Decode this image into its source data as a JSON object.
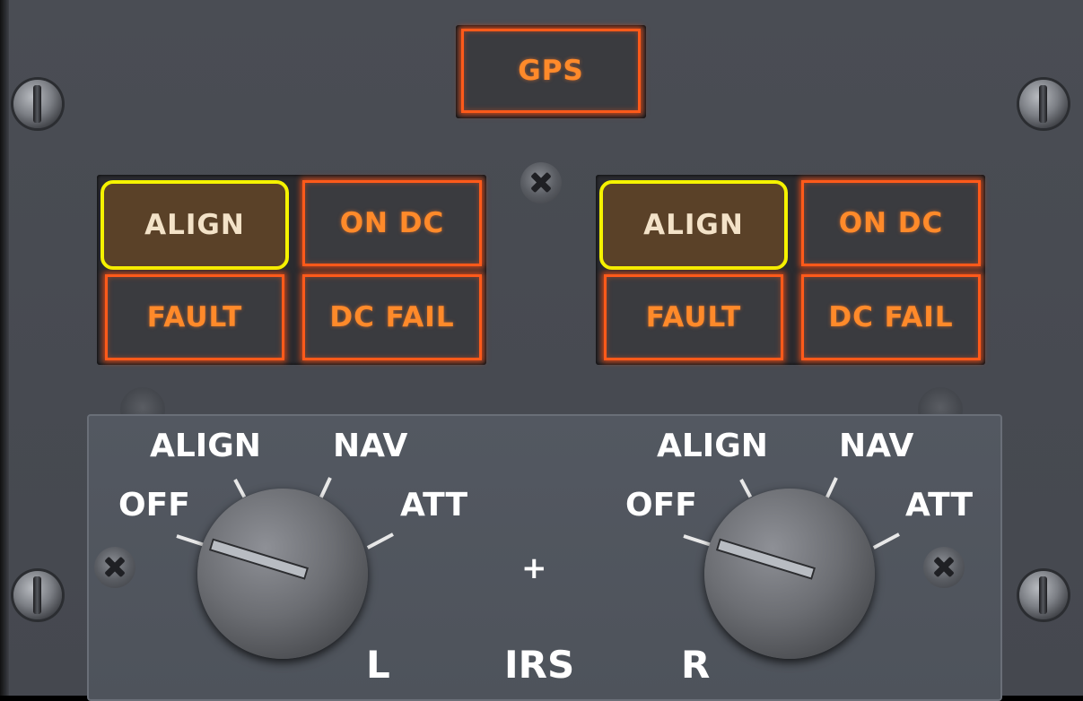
{
  "gps_lamp": {
    "label": "GPS",
    "color": "#ff5a1a"
  },
  "left_irs": {
    "align_button": "ALIGN",
    "on_dc_lamp": "ON DC",
    "fault_lamp": "FAULT",
    "dc_fail_lamp": "DC FAIL",
    "mode_labels": {
      "off": "OFF",
      "align": "ALIGN",
      "nav": "NAV",
      "att": "ATT"
    },
    "side_label": "L",
    "selected_mode": "OFF"
  },
  "right_irs": {
    "align_button": "ALIGN",
    "on_dc_lamp": "ON DC",
    "fault_lamp": "FAULT",
    "dc_fail_lamp": "DC FAIL",
    "mode_labels": {
      "off": "OFF",
      "align": "ALIGN",
      "nav": "NAV",
      "att": "ATT"
    },
    "side_label": "R",
    "selected_mode": "OFF"
  },
  "center": {
    "plus_mark": "+",
    "panel_label": "IRS"
  },
  "colors": {
    "align_highlight": "#f5f200",
    "align_fill": "#5a4128",
    "annunciator_text": "#ff8a2a"
  }
}
